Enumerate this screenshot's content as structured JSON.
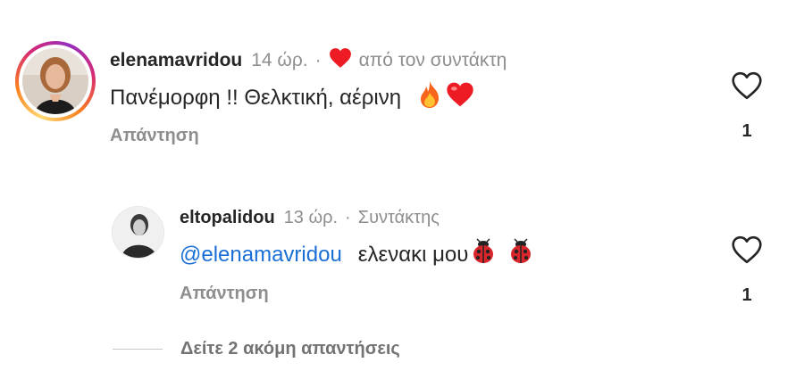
{
  "comments": [
    {
      "username": "elenamavridou",
      "time": "14 ώρ.",
      "separator": "·",
      "liked_by_author": "από τον συντάκτη",
      "text": "Πανέμορφη !! Θελκτική, αέρινη",
      "emojis": [
        "fire-emoji",
        "heart-emoji"
      ],
      "reply_label": "Απάντηση",
      "like_count": "1"
    },
    {
      "username": "eltopalidou",
      "time": "13 ώρ.",
      "separator": "·",
      "role": "Συντάκτης",
      "mention": "@elenamavridou",
      "text": "ελενακι μου",
      "emojis": [
        "ladybug-emoji",
        "ladybug-emoji"
      ],
      "reply_label": "Απάντηση",
      "like_count": "1"
    }
  ],
  "view_more_replies": "Δείτε 2 ακόμη απαντήσεις",
  "colors": {
    "text": "#262626",
    "secondary": "#8e8e8e",
    "mention": "#1a6fd6",
    "heart": "#ed1c24"
  }
}
